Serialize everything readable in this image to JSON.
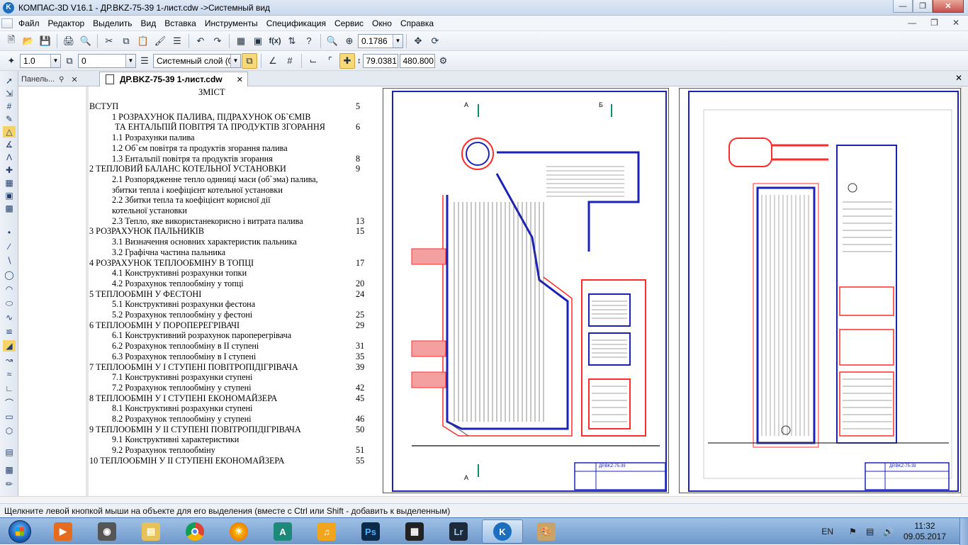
{
  "window": {
    "title": "КОМПАС-3D V16.1 - ДР.BKZ-75-39 1-лист.cdw ->Системный вид",
    "app_icon": "kompas-logo-icon"
  },
  "menu": {
    "items": [
      "Файл",
      "Редактор",
      "Выделить",
      "Вид",
      "Вставка",
      "Инструменты",
      "Спецификация",
      "Сервис",
      "Окно",
      "Справка"
    ]
  },
  "toolbar": {
    "zoom_value": "0.1786",
    "line_scale": "1.0",
    "layer_number": "0",
    "layer_name": "Системный слой (0)",
    "coord_x": "79.0381",
    "coord_y": "480.800"
  },
  "tabs": {
    "panel_label": "Панель...",
    "document_label": "ДР.BKZ-75-39 1-лист.cdw"
  },
  "toc": {
    "title": "ЗМІСТ",
    "lines": [
      {
        "text": "ВСТУП",
        "page": "5",
        "indent": 0
      },
      {
        "text": "1 РОЗРАХУНОК ПАЛИВА, ПІДРАХУНОК ОБ`ЄМІВ",
        "page": "",
        "indent": 2
      },
      {
        "text": "ТА ЕНТАЛЬПІЙ ПОВІТРЯ ТА ПРОДУКТІВ ЗГОРАННЯ",
        "page": "6",
        "indent": 3
      },
      {
        "text": "1.1 Розрахунки палива",
        "page": "",
        "indent": 1
      },
      {
        "text": "1.2 Об`єм повітря та продуктів згорання палива",
        "page": "",
        "indent": 1
      },
      {
        "text": "1.3 Ентальпії повітря та продуктів згорання",
        "page": "8",
        "indent": 1
      },
      {
        "text": "2 ТЕПЛОВИЙ БАЛАНС КОТЕЛЬНОЇ УСТАНОВКИ",
        "page": "9",
        "indent": 0
      },
      {
        "text": "2.1 Розпорядженне тепло одиниці маси (об`эма) палива,",
        "page": "",
        "indent": 1
      },
      {
        "text": "збитки тепла і коефіцієнт котельної установки",
        "page": "",
        "indent": 4
      },
      {
        "text": "2.2 Збитки тепла та коефіцієнт корисної дії",
        "page": "",
        "indent": 1
      },
      {
        "text": "котельної установки",
        "page": "",
        "indent": 4
      },
      {
        "text": "2.3 Тепло, яке використанекорисно і витрата палива",
        "page": "13",
        "indent": 1
      },
      {
        "text": "3 РОЗРАХУНОК ПАЛЬНИКІВ",
        "page": "15",
        "indent": 0
      },
      {
        "text": "3.1 Визначення основних характеристик пальника",
        "page": "",
        "indent": 1
      },
      {
        "text": "3.2 Графічна частина пальника",
        "page": "",
        "indent": 1
      },
      {
        "text": "4 РОЗРАХУНОК ТЕПЛООБМІНУ В ТОПЦІ",
        "page": "17",
        "indent": 0
      },
      {
        "text": "4.1 Конструктивні розрахунки топки",
        "page": "",
        "indent": 1
      },
      {
        "text": "4.2 Розрахунок теплообміну у топці",
        "page": "20",
        "indent": 1
      },
      {
        "text": "5 ТЕПЛООБМІН У ФЕСТОНІ",
        "page": "24",
        "indent": 0
      },
      {
        "text": "5.1 Конструктивні розрахунки фестона",
        "page": "",
        "indent": 1
      },
      {
        "text": "5.2 Розрахунок теплообміну у фестоні",
        "page": "25",
        "indent": 1
      },
      {
        "text": "6 ТЕПЛООБМІН У ПОРОПЕРЕГРІВАЧІ",
        "page": "29",
        "indent": 0
      },
      {
        "text": "6.1 Конструктивний розрахунок пароперегрівача",
        "page": "",
        "indent": 1
      },
      {
        "text": "6.2 Розрахунок теплообміну в ІІ ступені",
        "page": "31",
        "indent": 1
      },
      {
        "text": "6.3 Розрахунок теплообміну в І ступені",
        "page": "35",
        "indent": 1
      },
      {
        "text": "7 ТЕПЛООБМІН У І СТУПЕНІ ПОВІТРОПІДІГРІВАЧА",
        "page": "39",
        "indent": 0
      },
      {
        "text": "7.1 Конструктивні розрахунки ступені",
        "page": "",
        "indent": 1
      },
      {
        "text": "7.2 Розрахунок теплообміну у ступені",
        "page": "42",
        "indent": 1
      },
      {
        "text": "8 ТЕПЛООБМІН У І СТУПЕНІ ЕКОНОМАЙЗЕРА",
        "page": "45",
        "indent": 0
      },
      {
        "text": "8.1 Конструктивні розрахунки ступені",
        "page": "",
        "indent": 1
      },
      {
        "text": "8.2 Розрахунок теплообміну у ступені",
        "page": "46",
        "indent": 1
      },
      {
        "text": "9 ТЕПЛООБМІН У ІІ СТУПЕНІ ПОВІТРОПІДІГРІВАЧА",
        "page": "50",
        "indent": 0
      },
      {
        "text": "9.1 Конструктивні характеристики",
        "page": "",
        "indent": 1
      },
      {
        "text": "9.2 Розрахунок теплообміну",
        "page": "51",
        "indent": 1
      },
      {
        "text": "10 ТЕПЛООБМІН У ІІ СТУПЕНІ ЕКОНОМАЙЗЕРА",
        "page": "55",
        "indent": 0
      }
    ]
  },
  "drawing": {
    "section_label_a": "А",
    "section_label_b": "Б",
    "stamp_text": "ДР.BKZ-75-39",
    "blue": "#1b22b8",
    "red": "#ff2b2b",
    "pink": "#f08a8a"
  },
  "status": {
    "text": "Щелкните левой кнопкой мыши на объекте для его выделения (вместе с Ctrl или Shift - добавить к выделенным)"
  },
  "taskbar": {
    "apps": [
      "media-player-icon",
      "camera-app-icon",
      "file-explorer-icon",
      "chrome-icon",
      "firefox-icon",
      "autocad-icon",
      "audio-editor-icon",
      "photoshop-icon",
      "video-editor-icon",
      "lightroom-icon",
      "kompas-icon",
      "paint-icon"
    ],
    "language": "EN",
    "time": "11:32",
    "date": "09.05.2017"
  }
}
